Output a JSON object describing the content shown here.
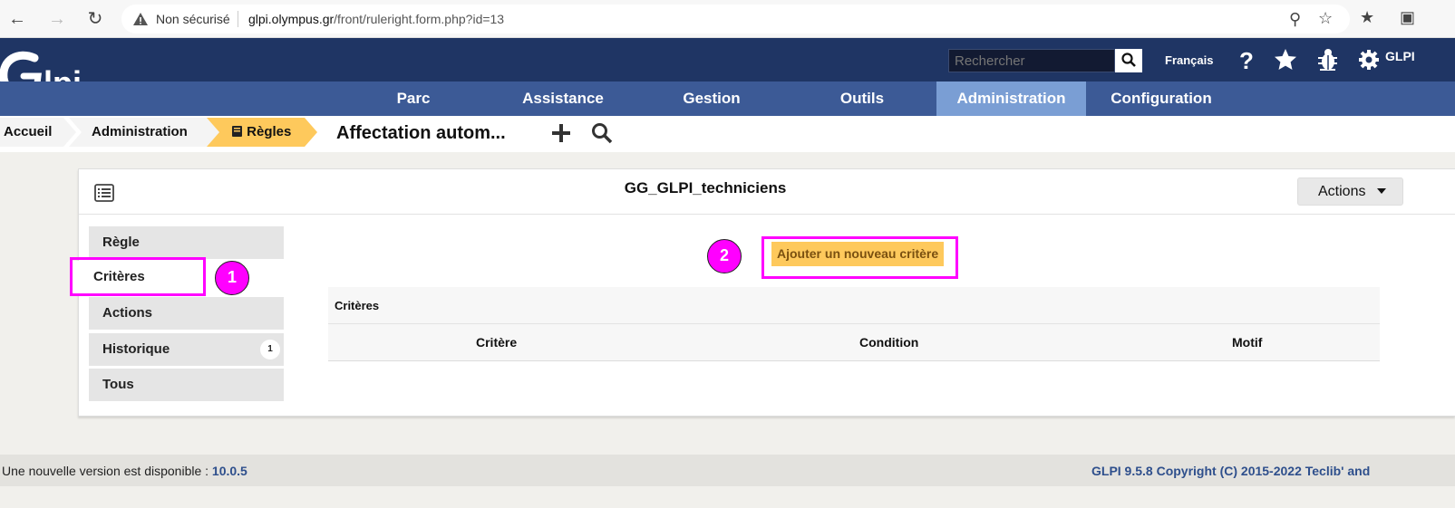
{
  "browser": {
    "security_label": "Non sécurisé",
    "url_host": "glpi.olympus.gr",
    "url_path": "/front/ruleright.form.php?id=13"
  },
  "header": {
    "search_placeholder": "Rechercher",
    "language": "Français",
    "user": "GLPI"
  },
  "menu": [
    {
      "label": "Parc"
    },
    {
      "label": "Assistance"
    },
    {
      "label": "Gestion"
    },
    {
      "label": "Outils"
    },
    {
      "label": "Administration",
      "active": true
    },
    {
      "label": "Configuration"
    }
  ],
  "breadcrumb": {
    "home": "Accueil",
    "section": "Administration",
    "current": "Règles",
    "page_title": "Affectation autom..."
  },
  "panel": {
    "title": "GG_GLPI_techniciens",
    "actions_label": "Actions"
  },
  "tabs": [
    {
      "label": "Règle"
    },
    {
      "label": "Critères",
      "active": true
    },
    {
      "label": "Actions"
    },
    {
      "label": "Historique",
      "badge": "1"
    },
    {
      "label": "Tous"
    }
  ],
  "criteria": {
    "add_button": "Ajouter un nouveau critère",
    "table_title": "Critères",
    "columns": [
      "Critère",
      "Condition",
      "Motif"
    ]
  },
  "annotations": {
    "step1": "1",
    "step2": "2"
  },
  "footer": {
    "update_text": "Une nouvelle version est disponible :",
    "update_version": "10.0.5",
    "copyright": "GLPI 9.5.8 Copyright (C) 2015-2022 Teclib' and"
  },
  "colors": {
    "header_dark": "#1f3564",
    "menu_bar": "#3c5a96",
    "menu_active": "#7a9ed4",
    "crumb_active": "#fec95c",
    "annotation": "#ff00ff"
  }
}
